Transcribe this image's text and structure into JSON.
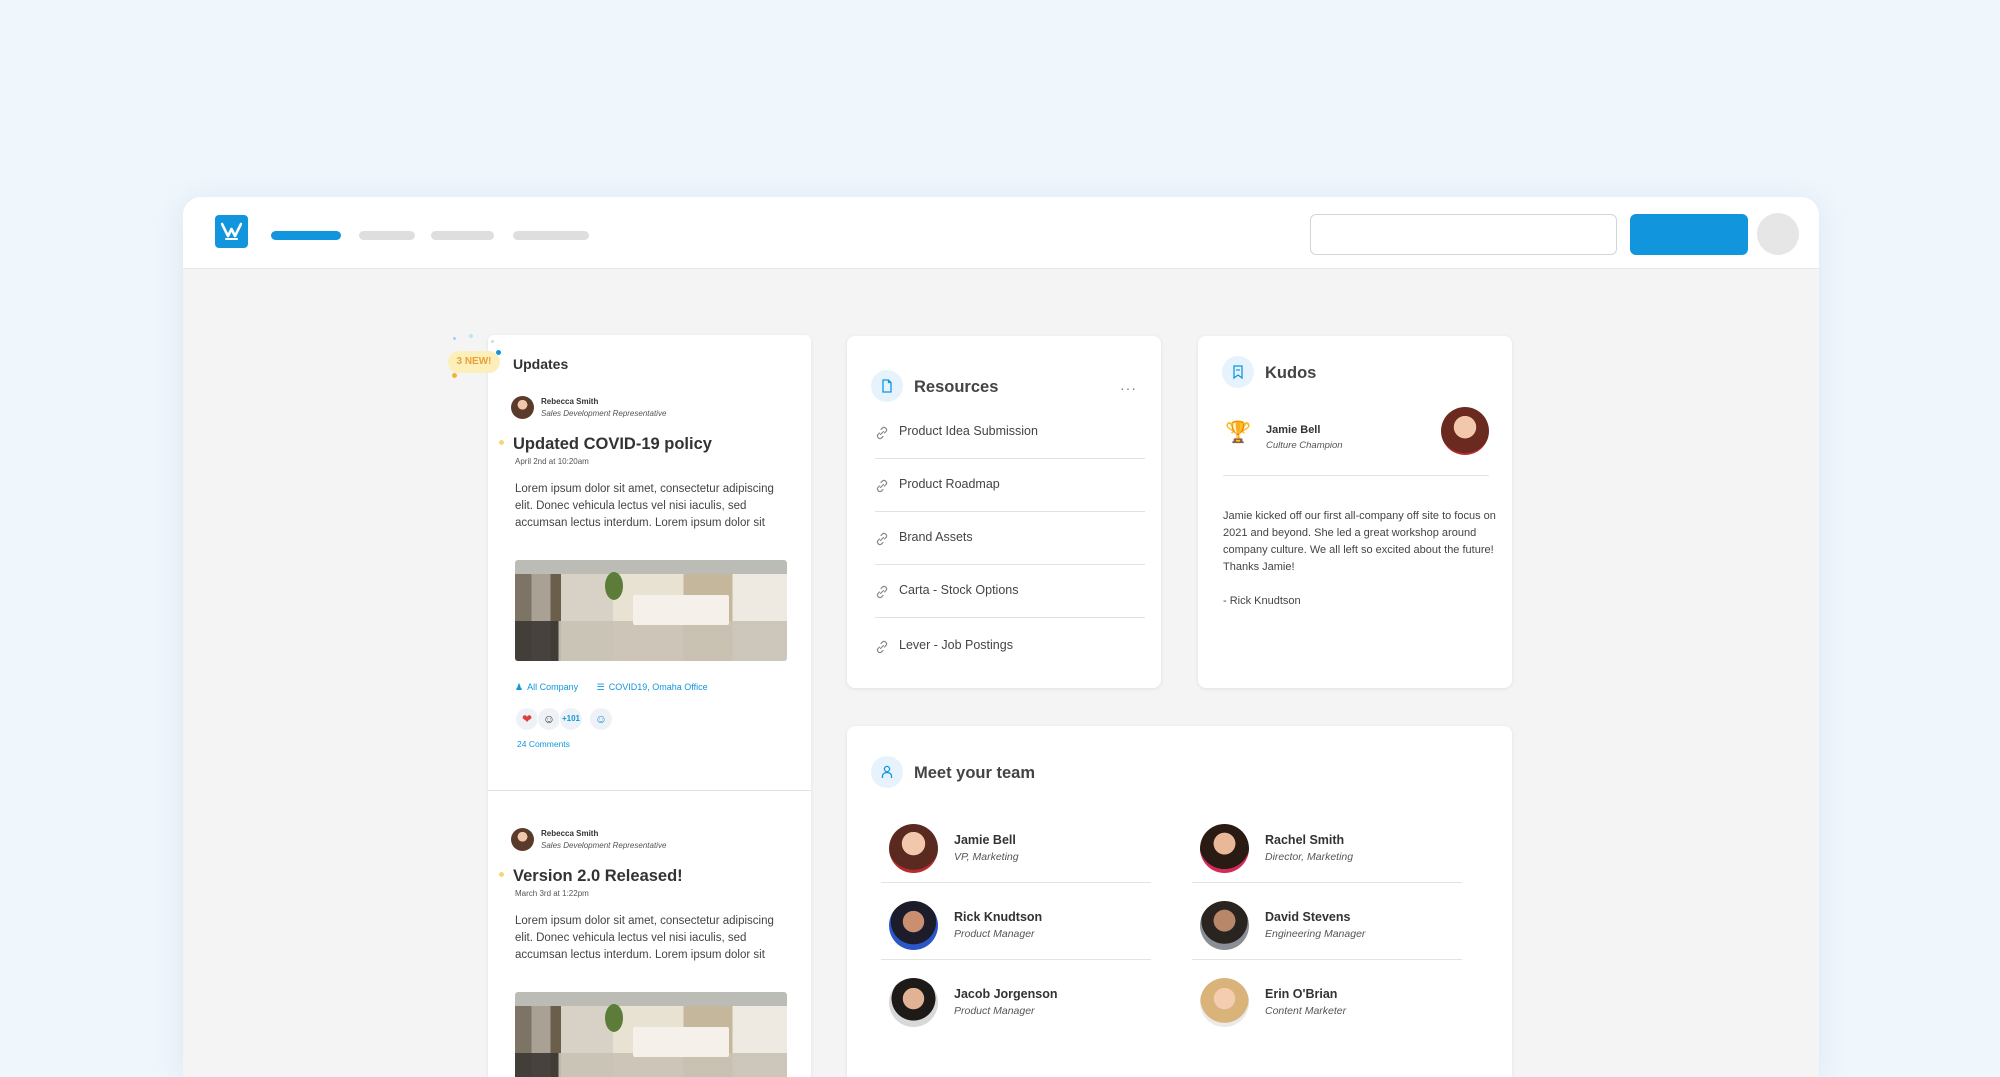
{
  "colors": {
    "accent": "#1196de",
    "badge_bg": "#fcefb9",
    "badge_text": "#e8a13a",
    "page_bg": "#eff6fc"
  },
  "header": {
    "logo_icon": "workvivo-logo-icon",
    "search_placeholder": ""
  },
  "updates": {
    "title": "Updates",
    "new_badge": "3 NEW!",
    "posts": [
      {
        "author": "Rebecca Smith",
        "role": "Sales Development Representative",
        "title": "Updated COVID-19 policy",
        "date": "April 2nd at 10:20am",
        "body": "Lorem ipsum dolor sit amet, consectetur adipiscing elit. Donec vehicula lectus vel nisi iaculis, sed accumsan lectus interdum. Lorem ipsum dolor sit",
        "audience": "All Company",
        "topics": "COVID19, Omaha Office",
        "reaction_count": "+101",
        "comments": "24 Comments"
      },
      {
        "author": "Rebecca Smith",
        "role": "Sales Development Representative",
        "title": "Version 2.0 Released!",
        "date": "March 3rd at 1:22pm",
        "body": "Lorem ipsum dolor sit amet, consectetur adipiscing elit. Donec vehicula lectus vel nisi iaculis, sed accumsan lectus interdum. Lorem ipsum dolor sit"
      }
    ]
  },
  "resources": {
    "title": "Resources",
    "more": "···",
    "items": [
      {
        "label": "Product Idea Submission"
      },
      {
        "label": "Product Roadmap"
      },
      {
        "label": "Brand Assets"
      },
      {
        "label": "Carta - Stock Options"
      },
      {
        "label": "Lever - Job Postings"
      }
    ]
  },
  "kudos": {
    "title": "Kudos",
    "name": "Jamie Bell",
    "role": "Culture Champion",
    "text": "Jamie kicked off our first all-company off site to focus on 2021 and beyond. She led a great workshop around company culture. We all left so excited about the future! Thanks Jamie!",
    "signature": "- Rick Knudtson"
  },
  "team": {
    "title": "Meet your team",
    "members": [
      {
        "name": "Jamie Bell",
        "role": "VP, Marketing"
      },
      {
        "name": "Rachel Smith",
        "role": "Director, Marketing"
      },
      {
        "name": "Rick Knudtson",
        "role": "Product Manager"
      },
      {
        "name": "David Stevens",
        "role": "Engineering Manager"
      },
      {
        "name": "Jacob Jorgenson",
        "role": "Product Manager"
      },
      {
        "name": "Erin O'Brian",
        "role": "Content Marketer"
      }
    ]
  }
}
